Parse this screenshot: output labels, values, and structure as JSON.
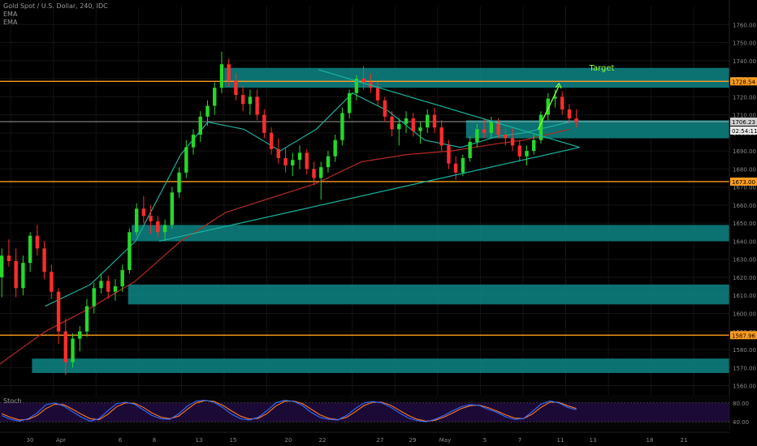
{
  "header": {
    "title": "Gold Spot / U.S. Dollar, 240, IDC",
    "ema_1": "EMA",
    "ema_2": "EMA"
  },
  "annotation": {
    "target_label": "Target"
  },
  "stoch": {
    "label": "Stoch",
    "levels": [
      "80.00",
      "40.00"
    ]
  },
  "colors": {
    "background": "#000000",
    "zone": "#0e8585",
    "level_line": "#ff9c1f",
    "level_badge": "#ff9c1f",
    "current_badge": "#cfcfcf",
    "candle_up": "#25d82a",
    "candle_down": "#ff2c2c",
    "ema_fast": "#1fae9e",
    "ema_slow": "#b42a22",
    "trendline": "#17b5a0",
    "target": "#8cff3c",
    "stoch_bg": "#1c0a36",
    "stoch_k": "#2f6fff",
    "stoch_d": "#ff7a22"
  },
  "chart_data": {
    "type": "candlestick",
    "title": "Gold Spot / U.S. Dollar, 240, IDC",
    "timeframe": "240",
    "ylim": [
      1558,
      1770
    ],
    "y_ticks": [
      1560,
      1570,
      1580,
      1590,
      1600,
      1610,
      1620,
      1630,
      1640,
      1650,
      1660,
      1670,
      1680,
      1690,
      1700,
      1710,
      1720,
      1730,
      1740,
      1750,
      1760
    ],
    "x_ticks": [
      "30",
      "Apr",
      "6",
      "8",
      "13",
      "15",
      "20",
      "22",
      "27",
      "29",
      "May",
      "5",
      "7",
      "11",
      "13",
      "18",
      "21"
    ],
    "price_badges": [
      {
        "value": "1728.54",
        "kind": "level"
      },
      {
        "value": "1706.23",
        "kind": "current"
      },
      {
        "value": "02:54:11",
        "kind": "countdown"
      },
      {
        "value": "1673.00",
        "kind": "level"
      },
      {
        "value": "1587.96",
        "kind": "level"
      }
    ],
    "horizontal_levels": [
      1728.54,
      1673.0,
      1587.96,
      1706.23
    ],
    "zones": [
      {
        "from_index": 7,
        "to": "right",
        "low": 1725,
        "high": 1736
      },
      {
        "from_index": 16,
        "to": "right",
        "low": 1697,
        "high": 1707
      },
      {
        "from_index": 0,
        "to": "right",
        "low": 1640,
        "high": 1649
      },
      {
        "from_index": 0,
        "to": "right",
        "low": 1605,
        "high": 1616
      },
      {
        "from_index": 1,
        "to": "right",
        "low": 1567,
        "high": 1575
      }
    ],
    "trendlines": [
      {
        "from": [
          5,
          1640
        ],
        "to": [
          18.2,
          1692
        ]
      },
      {
        "from": [
          10,
          1735
        ],
        "to": [
          18.2,
          1692
        ]
      }
    ],
    "target_arrow": {
      "from": [
        16.9,
        1702
      ],
      "to": [
        17.4,
        1726
      ]
    },
    "candles": [
      [
        1,
        1620,
        1636,
        1609,
        1632
      ],
      [
        1,
        1632,
        1641,
        1626,
        1629
      ],
      [
        1,
        1629,
        1636,
        1609,
        1614
      ],
      [
        1,
        1614,
        1632,
        1610,
        1628
      ],
      [
        1,
        1628,
        1645,
        1623,
        1643
      ],
      [
        1,
        1643,
        1649,
        1632,
        1636
      ],
      [
        1,
        1636,
        1640,
        1619,
        1623
      ],
      [
        1,
        1623,
        1627,
        1608,
        1612
      ],
      [
        1,
        1612,
        1614,
        1583,
        1590
      ],
      [
        1,
        1590,
        1597,
        1566,
        1573
      ],
      [
        1,
        1573,
        1589,
        1570,
        1586
      ],
      [
        1,
        1586,
        1593,
        1579,
        1590
      ],
      [
        1,
        1590,
        1608,
        1587,
        1604
      ],
      [
        1,
        1604,
        1617,
        1600,
        1614
      ],
      [
        1,
        1614,
        1622,
        1611,
        1618
      ],
      [
        1,
        1618,
        1621,
        1608,
        1612
      ],
      [
        1,
        1612,
        1619,
        1607,
        1615
      ],
      [
        1,
        1615,
        1627,
        1612,
        1624
      ],
      [
        2,
        1624,
        1647,
        1622,
        1645
      ],
      [
        2,
        1645,
        1661,
        1643,
        1658
      ],
      [
        2,
        1658,
        1665,
        1650,
        1654
      ],
      [
        2,
        1654,
        1660,
        1644,
        1651
      ],
      [
        2,
        1651,
        1654,
        1642,
        1645
      ],
      [
        2,
        1645,
        1652,
        1640,
        1649
      ],
      [
        3,
        1649,
        1670,
        1647,
        1667
      ],
      [
        3,
        1667,
        1681,
        1664,
        1678
      ],
      [
        3,
        1678,
        1696,
        1675,
        1692
      ],
      [
        3,
        1692,
        1702,
        1688,
        1699
      ],
      [
        3,
        1699,
        1712,
        1695,
        1709
      ],
      [
        3,
        1709,
        1718,
        1704,
        1715
      ],
      [
        4,
        1715,
        1728,
        1710,
        1725
      ],
      [
        4,
        1725,
        1745,
        1722,
        1738
      ],
      [
        4,
        1738,
        1741,
        1726,
        1729
      ],
      [
        4,
        1729,
        1733,
        1718,
        1721
      ],
      [
        4,
        1721,
        1726,
        1712,
        1716
      ],
      [
        4,
        1716,
        1724,
        1710,
        1720
      ],
      [
        5,
        1720,
        1724,
        1707,
        1710
      ],
      [
        5,
        1710,
        1713,
        1697,
        1700
      ],
      [
        5,
        1700,
        1703,
        1688,
        1691
      ],
      [
        5,
        1691,
        1697,
        1683,
        1686
      ],
      [
        5,
        1686,
        1692,
        1678,
        1682
      ],
      [
        5,
        1682,
        1689,
        1676,
        1685
      ],
      [
        6,
        1685,
        1693,
        1680,
        1689
      ],
      [
        6,
        1689,
        1691,
        1677,
        1680
      ],
      [
        6,
        1680,
        1684,
        1671,
        1675
      ],
      [
        6,
        1675,
        1684,
        1663,
        1681
      ],
      [
        6,
        1681,
        1690,
        1678,
        1687
      ],
      [
        6,
        1687,
        1699,
        1684,
        1696
      ],
      [
        7,
        1696,
        1714,
        1693,
        1711
      ],
      [
        7,
        1711,
        1724,
        1708,
        1722
      ],
      [
        7,
        1722,
        1732,
        1718,
        1730
      ],
      [
        7,
        1730,
        1737,
        1724,
        1728
      ],
      [
        7,
        1728,
        1733,
        1722,
        1725
      ],
      [
        7,
        1725,
        1728,
        1715,
        1718
      ],
      [
        8,
        1718,
        1720,
        1706,
        1709
      ],
      [
        8,
        1709,
        1712,
        1698,
        1702
      ],
      [
        8,
        1702,
        1708,
        1693,
        1705
      ],
      [
        8,
        1705,
        1712,
        1700,
        1708
      ],
      [
        8,
        1708,
        1711,
        1698,
        1701
      ],
      [
        8,
        1701,
        1706,
        1694,
        1703
      ],
      [
        9,
        1703,
        1713,
        1700,
        1710
      ],
      [
        9,
        1710,
        1714,
        1700,
        1703
      ],
      [
        9,
        1703,
        1707,
        1690,
        1693
      ],
      [
        9,
        1693,
        1696,
        1680,
        1683
      ],
      [
        9,
        1683,
        1687,
        1674,
        1678
      ],
      [
        9,
        1678,
        1688,
        1676,
        1686
      ],
      [
        10,
        1686,
        1698,
        1684,
        1695
      ],
      [
        10,
        1695,
        1705,
        1692,
        1702
      ],
      [
        10,
        1702,
        1708,
        1697,
        1700
      ],
      [
        10,
        1700,
        1709,
        1697,
        1706
      ],
      [
        10,
        1706,
        1708,
        1697,
        1699
      ],
      [
        10,
        1699,
        1702,
        1693,
        1697
      ],
      [
        11,
        1697,
        1703,
        1690,
        1693
      ],
      [
        11,
        1693,
        1696,
        1684,
        1687
      ],
      [
        11,
        1687,
        1693,
        1682,
        1690
      ],
      [
        11,
        1690,
        1699,
        1688,
        1696
      ],
      [
        11,
        1696,
        1712,
        1694,
        1710
      ],
      [
        11,
        1710,
        1722,
        1707,
        1719
      ],
      [
        12,
        1719,
        1724,
        1714,
        1720
      ],
      [
        12,
        1720,
        1723,
        1710,
        1713
      ],
      [
        12,
        1713,
        1716,
        1705,
        1708
      ],
      [
        12,
        1708,
        1713,
        1703,
        1706
      ]
    ],
    "ema_fast": [
      [
        1,
        1604
      ],
      [
        2,
        1616
      ],
      [
        3,
        1640
      ],
      [
        4,
        1688
      ],
      [
        4.6,
        1706
      ],
      [
        5.4,
        1702
      ],
      [
        6.2,
        1690
      ],
      [
        7,
        1702
      ],
      [
        7.8,
        1722
      ],
      [
        8.6,
        1712
      ],
      [
        9.4,
        1696
      ],
      [
        10.2,
        1692
      ],
      [
        11,
        1698
      ],
      [
        11.6,
        1700
      ],
      [
        12.6,
        1706
      ]
    ],
    "ema_slow": [
      [
        0,
        1572
      ],
      [
        1,
        1590
      ],
      [
        2,
        1603
      ],
      [
        3,
        1618
      ],
      [
        4,
        1640
      ],
      [
        5,
        1656
      ],
      [
        6,
        1664
      ],
      [
        7,
        1672
      ],
      [
        8,
        1684
      ],
      [
        9,
        1688
      ],
      [
        10,
        1690
      ],
      [
        11,
        1694
      ],
      [
        11.6,
        1696
      ],
      [
        12.6,
        1702
      ]
    ],
    "stoch_k": [
      40,
      28,
      22,
      30,
      48,
      74,
      80,
      70,
      52,
      35,
      22,
      30,
      55,
      78,
      82,
      76,
      58,
      40,
      30,
      28,
      45,
      70,
      86,
      88,
      82,
      65,
      44,
      30,
      26,
      34,
      55,
      80,
      88,
      85,
      72,
      50,
      34,
      28,
      26,
      40,
      62,
      80,
      84,
      80,
      66,
      48,
      32,
      24,
      20,
      28,
      40,
      55,
      68,
      74,
      72,
      60,
      50,
      36,
      28,
      30,
      52,
      76,
      86,
      80,
      66,
      58
    ],
    "stoch_d": [
      46,
      34,
      26,
      28,
      40,
      62,
      76,
      74,
      60,
      44,
      30,
      27,
      44,
      68,
      80,
      79,
      66,
      48,
      35,
      30,
      38,
      60,
      80,
      87,
      85,
      72,
      54,
      38,
      29,
      31,
      46,
      70,
      85,
      86,
      78,
      60,
      42,
      31,
      27,
      34,
      52,
      72,
      82,
      82,
      72,
      56,
      40,
      28,
      22,
      25,
      35,
      48,
      62,
      71,
      73,
      65,
      54,
      42,
      32,
      30,
      44,
      66,
      82,
      82,
      71,
      62
    ]
  }
}
